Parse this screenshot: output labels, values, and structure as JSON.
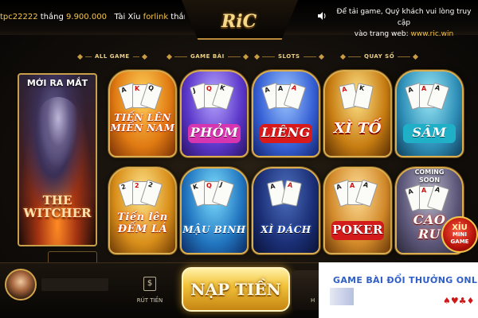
{
  "top_bar": {
    "ticker": {
      "user": "tpc22222",
      "mid": "thắng",
      "amount": "9.900.000",
      "game_text": "Tài Xỉu",
      "user2": "forlink",
      "tail": "thắn"
    },
    "logo_text": "RiC",
    "notice": {
      "line1": "Để tải game, Quý khách vui lòng truy cập",
      "line2_prefix": "vào trang web:",
      "site": "www.ric.win"
    }
  },
  "categories": [
    "ALL GAME",
    "GAME BÀI",
    "SLOTS",
    "QUAY SỐ"
  ],
  "featured": {
    "badge": "MỚI RA MẮT",
    "title_line1": "THE",
    "title_line2": "WITCHER"
  },
  "games": [
    {
      "id": "tien-len-mien-nam",
      "line1": "TIẾN LÊN",
      "line2": "MIỀN NAM"
    },
    {
      "id": "phom",
      "line1": "PHỎM",
      "line2": ""
    },
    {
      "id": "lieng",
      "line1": "LIÊNG",
      "line2": ""
    },
    {
      "id": "xi-to",
      "line1": "XÌ TỐ",
      "line2": ""
    },
    {
      "id": "sam",
      "line1": "SÂM",
      "line2": ""
    },
    {
      "id": "tien-len-dem-la",
      "line1": "Tiến lên",
      "line2": "ĐẾM LÁ"
    },
    {
      "id": "mau-binh",
      "line1": "MẬU BINH",
      "line2": ""
    },
    {
      "id": "xi-dach",
      "line1": "XÌ DÁCH",
      "line2": ""
    },
    {
      "id": "poker",
      "line1": "POKER",
      "line2": ""
    },
    {
      "id": "cao-ru",
      "line1": "CAO",
      "line2": "RU",
      "badge_line1": "COMING",
      "badge_line2": "SOON"
    }
  ],
  "mini_game": {
    "top": "XỈU",
    "line1": "MINI",
    "line2": "GAME"
  },
  "bottom_bar": {
    "withdraw_label": "RÚT TIỀN",
    "deposit_label": "NẠP TIỀN",
    "right_stub_label": "H"
  },
  "watermark": {
    "text": "GAME BÀI ĐỔI THƯỞNG ONLINE",
    "suits": "♠♥♣♦"
  },
  "colors": {
    "gold": "#f3c64a",
    "accent_blue": "#2f5fc6",
    "bg": "#0c0a08"
  },
  "icons": [
    "speaker-icon",
    "withdraw-icon"
  ]
}
